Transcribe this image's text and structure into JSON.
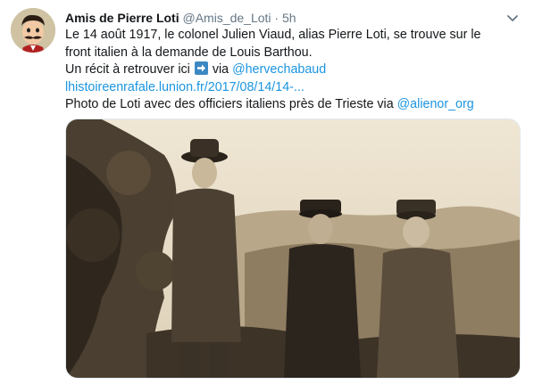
{
  "tweet": {
    "author_name": "Amis de Pierre Loti",
    "author_handle": "@Amis_de_Loti",
    "separator": "·",
    "time": "5h",
    "line1": "Le 14 août 1917, le colonel Julien Viaud, alias Pierre Loti, se trouve sur le",
    "line2": "front italien à la demande de Louis Barthou.",
    "line3_prefix": "Un récit à retrouver ici",
    "line3_via": "via",
    "mention1": "@hervechabaud",
    "url": "lhistoireenrafale.lunion.fr/2017/08/14/14-...",
    "line5_prefix": "Photo de Loti avec des officiers italiens près de Trieste via",
    "mention2": "@alienor_org"
  },
  "icons": {
    "avatar": "cartoon-avatar",
    "caret": "chevron-down-icon",
    "arrow": "right-arrow-emoji"
  },
  "colors": {
    "link": "#1b95e0",
    "secondary_text": "#657786",
    "primary_text": "#14171a",
    "emoji_blue": "#3b88c3",
    "photo_sepia": "#e7dcc7"
  }
}
